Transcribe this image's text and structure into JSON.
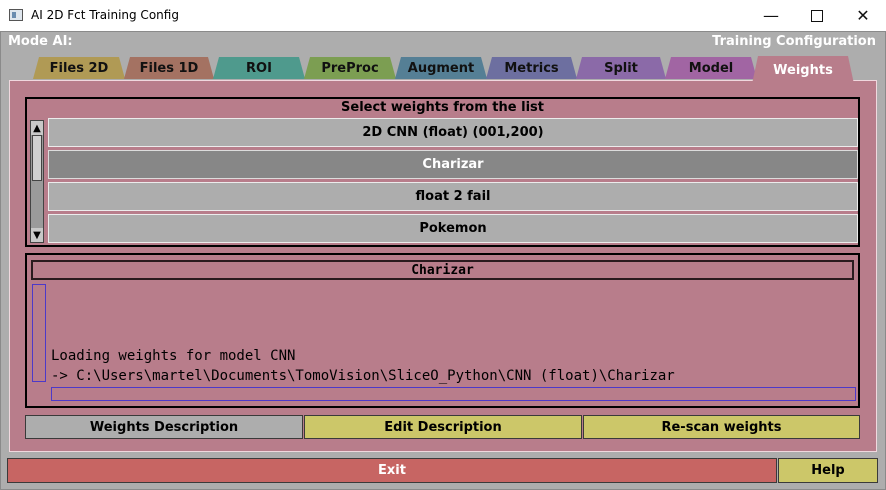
{
  "window": {
    "title": "AI 2D Fct Training Config",
    "minimize_glyph": "—",
    "close_glyph": "✕"
  },
  "header": {
    "mode_label": "Mode AI:",
    "config_label": "Training Configuration"
  },
  "tabs": [
    {
      "label": "Files 2D",
      "color": "#b09a55"
    },
    {
      "label": "Files 1D",
      "color": "#a47262"
    },
    {
      "label": "ROI",
      "color": "#4f9a8d"
    },
    {
      "label": "PreProc",
      "color": "#7c9e52"
    },
    {
      "label": "Augment",
      "color": "#557f95"
    },
    {
      "label": "Metrics",
      "color": "#6d6fa0"
    },
    {
      "label": "Split",
      "color": "#8b6aa8"
    },
    {
      "label": "Model",
      "color": "#a165a3"
    },
    {
      "label": "Weights",
      "color": "#b87d8b",
      "active": true
    }
  ],
  "weights_list": {
    "header": "Select weights from the list",
    "scroll_up_glyph": "▲",
    "scroll_down_glyph": "▼",
    "items": [
      {
        "label": "2D CNN (float) (001,200)"
      },
      {
        "label": "Charizar",
        "selected": true
      },
      {
        "label": "float 2 fail"
      },
      {
        "label": "Pokemon"
      }
    ]
  },
  "description": {
    "title": "Charizar",
    "log_lines": [
      "Loading weights for model CNN",
      "-> C:\\Users\\martel\\Documents\\TomoVision\\SliceO_Python\\CNN (float)\\Charizar"
    ]
  },
  "buttons": {
    "weights_description": "Weights Description",
    "edit_description": "Edit Description",
    "rescan_weights": "Re-scan weights",
    "exit": "Exit",
    "help": "Help"
  },
  "colors": {
    "panel": "#b87d8b",
    "background": "#adadad",
    "yellow_button": "#ccc769",
    "exit_button": "#c76563",
    "text_box_border": "#4d39c9"
  }
}
